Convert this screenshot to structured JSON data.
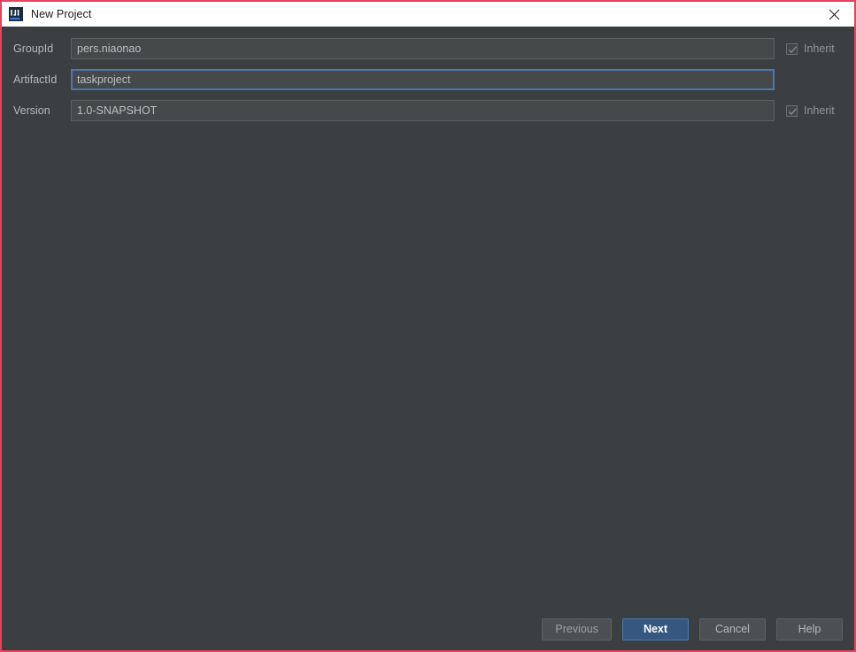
{
  "window": {
    "title": "New Project",
    "app_icon": "intellij-idea-icon",
    "close_icon": "close-icon",
    "border_color": "#e8415a",
    "titlebar_bg": "#ffffff",
    "body_bg": "#3c3f41"
  },
  "form": {
    "fields": [
      {
        "label": "GroupId",
        "value": "pers.niaonao",
        "placeholder": "",
        "focused": false,
        "inherit": {
          "label": "Inherit",
          "checked": true,
          "enabled": false
        }
      },
      {
        "label": "ArtifactId",
        "value": "taskproject",
        "placeholder": "",
        "focused": true,
        "inherit": null
      },
      {
        "label": "Version",
        "value": "1.0-SNAPSHOT",
        "placeholder": "",
        "focused": false,
        "inherit": {
          "label": "Inherit",
          "checked": true,
          "enabled": false
        }
      }
    ]
  },
  "footer": {
    "previous_label": "Previous",
    "next_label": "Next",
    "cancel_label": "Cancel",
    "help_label": "Help",
    "primary_color": "#365880"
  }
}
